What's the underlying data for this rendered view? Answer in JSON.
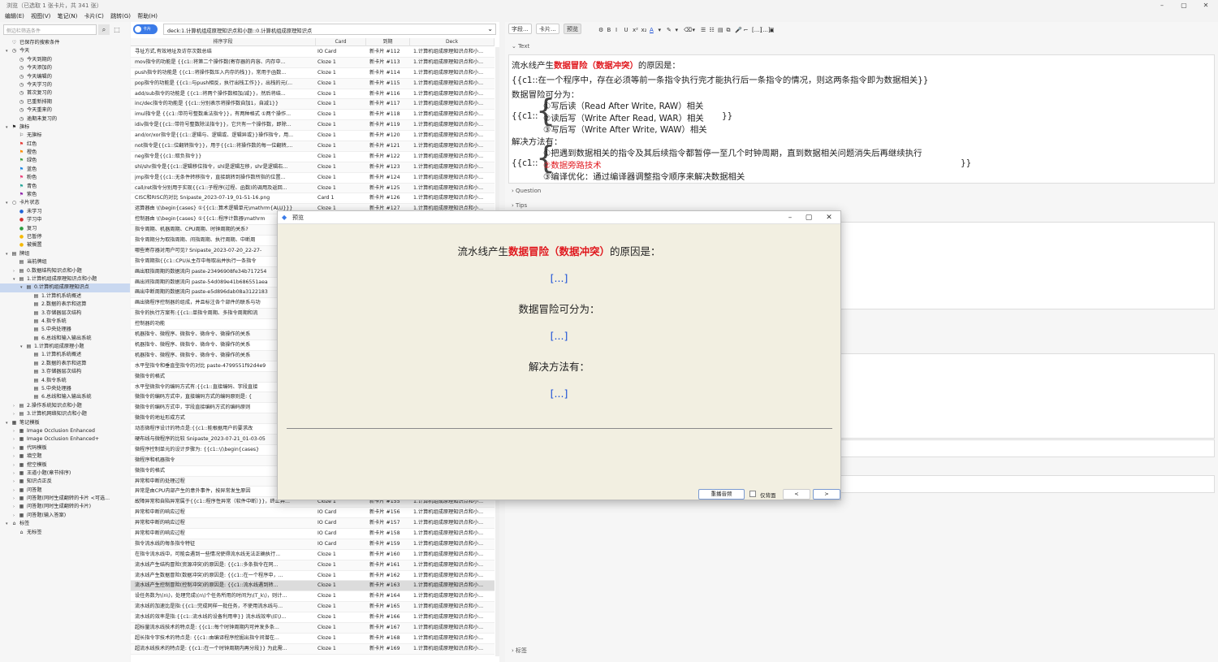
{
  "window": {
    "title": "浏览（已选取 1 张卡片，共 341 张）",
    "controls": [
      "–",
      "▢",
      "✕"
    ]
  },
  "menu": [
    "编辑(E)",
    "视图(V)",
    "笔记(N)",
    "卡片(C)",
    "跳转(G)",
    "帮助(H)"
  ],
  "sidebar": {
    "search_placeholder": "侧边栏筛选条件",
    "tree": [
      {
        "d": 0,
        "a": "",
        "i": "♡",
        "l": "已保存的搜索条件"
      },
      {
        "d": 0,
        "a": "▾",
        "i": "◷",
        "l": "今天"
      },
      {
        "d": 1,
        "a": "",
        "i": "◷",
        "l": "今天到期的"
      },
      {
        "d": 1,
        "a": "",
        "i": "◷",
        "l": "今天添加的"
      },
      {
        "d": 1,
        "a": "",
        "i": "◷",
        "l": "今天编辑的"
      },
      {
        "d": 1,
        "a": "",
        "i": "◷",
        "l": "今天学习的"
      },
      {
        "d": 1,
        "a": "",
        "i": "◷",
        "l": "首次复习的"
      },
      {
        "d": 1,
        "a": "",
        "i": "◷",
        "l": "已重新排期"
      },
      {
        "d": 1,
        "a": "",
        "i": "◷",
        "l": "今天重来的"
      },
      {
        "d": 1,
        "a": "",
        "i": "◷",
        "l": "逾期未复习的"
      },
      {
        "d": 0,
        "a": "▾",
        "i": "⚑",
        "l": "旗标"
      },
      {
        "d": 1,
        "a": "",
        "i": "⚐",
        "l": "无旗标"
      },
      {
        "d": 1,
        "a": "",
        "i": "⚑",
        "l": "红色",
        "c": "#e53935"
      },
      {
        "d": 1,
        "a": "",
        "i": "⚑",
        "l": "橙色",
        "c": "#fb8c00"
      },
      {
        "d": 1,
        "a": "",
        "i": "⚑",
        "l": "绿色",
        "c": "#43a047"
      },
      {
        "d": 1,
        "a": "",
        "i": "⚑",
        "l": "蓝色",
        "c": "#1e88e5"
      },
      {
        "d": 1,
        "a": "",
        "i": "⚑",
        "l": "粉色",
        "c": "#ec407a"
      },
      {
        "d": 1,
        "a": "",
        "i": "⚑",
        "l": "青色",
        "c": "#26a69a"
      },
      {
        "d": 1,
        "a": "",
        "i": "⚑",
        "l": "紫色",
        "c": "#8e24aa"
      },
      {
        "d": 0,
        "a": "▾",
        "i": "○",
        "l": "卡片状态"
      },
      {
        "d": 1,
        "a": "",
        "i": "●",
        "l": "未学习",
        "c": "#1e63d6"
      },
      {
        "d": 1,
        "a": "",
        "i": "●",
        "l": "学习中",
        "c": "#d32f2f"
      },
      {
        "d": 1,
        "a": "",
        "i": "●",
        "l": "复习",
        "c": "#2e9e3e"
      },
      {
        "d": 1,
        "a": "",
        "i": "●",
        "l": "已暂停",
        "c": "#f5b800"
      },
      {
        "d": 1,
        "a": "",
        "i": "●",
        "l": "被搁置",
        "c": "#f5b800"
      },
      {
        "d": 0,
        "a": "▾",
        "i": "▤",
        "l": "牌组"
      },
      {
        "d": 1,
        "a": "",
        "i": "▤",
        "l": "当前牌组"
      },
      {
        "d": 1,
        "a": "›",
        "i": "▤",
        "l": "0.数据结构知识点和小题"
      },
      {
        "d": 1,
        "a": "▾",
        "i": "▤",
        "l": "1.计算机组成原理知识点和小题"
      },
      {
        "d": 2,
        "a": "▾",
        "i": "▤",
        "l": "0.计算机组成原理知识点",
        "sel": true
      },
      {
        "d": 3,
        "a": "",
        "i": "▤",
        "l": "1.计算机系统概述"
      },
      {
        "d": 3,
        "a": "",
        "i": "▤",
        "l": "2.数据的表示和运算"
      },
      {
        "d": 3,
        "a": "",
        "i": "▤",
        "l": "3.存储器层次结构"
      },
      {
        "d": 3,
        "a": "",
        "i": "▤",
        "l": "4.指令系统"
      },
      {
        "d": 3,
        "a": "",
        "i": "▤",
        "l": "5.中央处理器"
      },
      {
        "d": 3,
        "a": "",
        "i": "▤",
        "l": "6.总线和输入输出系统"
      },
      {
        "d": 2,
        "a": "▾",
        "i": "▤",
        "l": "1.计算机组成原理小题"
      },
      {
        "d": 3,
        "a": "",
        "i": "▤",
        "l": "1.计算机系统概述"
      },
      {
        "d": 3,
        "a": "",
        "i": "▤",
        "l": "2.数据的表示和运算"
      },
      {
        "d": 3,
        "a": "",
        "i": "▤",
        "l": "3.存储器层次结构"
      },
      {
        "d": 3,
        "a": "",
        "i": "▤",
        "l": "4.指令系统"
      },
      {
        "d": 3,
        "a": "",
        "i": "▤",
        "l": "5.中央处理器"
      },
      {
        "d": 3,
        "a": "",
        "i": "▤",
        "l": "6.总线和输入输出系统"
      },
      {
        "d": 1,
        "a": "›",
        "i": "▤",
        "l": "2.操作系统知识点和小题"
      },
      {
        "d": 1,
        "a": "›",
        "i": "▤",
        "l": "3.计算机网络知识点和小题"
      },
      {
        "d": 0,
        "a": "▾",
        "i": "▦",
        "l": "笔记模板"
      },
      {
        "d": 1,
        "a": "›",
        "i": "▦",
        "l": "Image Occlusion Enhanced"
      },
      {
        "d": 1,
        "a": "›",
        "i": "▦",
        "l": "Image Occlusion Enhanced+"
      },
      {
        "d": 1,
        "a": "›",
        "i": "▦",
        "l": "代码模板"
      },
      {
        "d": 1,
        "a": "›",
        "i": "▦",
        "l": "填空题"
      },
      {
        "d": 1,
        "a": "›",
        "i": "▦",
        "l": "挖空模板"
      },
      {
        "d": 1,
        "a": "›",
        "i": "▦",
        "l": "王道小题(章节排序)"
      },
      {
        "d": 1,
        "a": "›",
        "i": "▦",
        "l": "知识点正反"
      },
      {
        "d": 1,
        "a": "›",
        "i": "▦",
        "l": "问答题"
      },
      {
        "d": 1,
        "a": "›",
        "i": "▦",
        "l": "问答题(同时生成翻转的卡片 <可选..."
      },
      {
        "d": 1,
        "a": "›",
        "i": "▦",
        "l": "问答题(同时生成翻转的卡片)"
      },
      {
        "d": 1,
        "a": "›",
        "i": "▦",
        "l": "问答题(输入答案)"
      },
      {
        "d": 0,
        "a": "▾",
        "i": "⌂",
        "l": "标签"
      },
      {
        "d": 1,
        "a": "",
        "i": "⌂",
        "l": "无标签"
      }
    ]
  },
  "browser": {
    "toggle_label": "卡片",
    "query": "deck:1.计算机组成原理知识点和小题::0.计算机组成原理知识点",
    "columns": [
      "排序字段",
      "Card",
      "到期",
      "Deck"
    ],
    "rows": [
      [
        "寻址方式,有效地址及访存次数总结",
        "IO Card",
        "新卡片 #112",
        "1.计算机组成原理知识点和小..."
      ],
      [
        "mov指令的功能是 {{c1::将第二个操作数(寄存器的内容、内存中...",
        "Cloze 1",
        "新卡片 #113",
        "1.计算机组成原理知识点和小..."
      ],
      [
        "push指令的功能是 {{c1::将操作数压入内存的栈}}，常用于函数...",
        "Cloze 1",
        "新卡片 #114",
        "1.计算机组成原理知识点和小..."
      ],
      [
        "pop指令的功能是 {{c1::与push相反，执行出栈工作}}，出栈的元(...",
        "Cloze 1",
        "新卡片 #115",
        "1.计算机组成原理知识点和小..."
      ],
      [
        "add/sub指令的功能是 {{c1::将两个操作数相加/减}}，然后将结...",
        "Cloze 1",
        "新卡片 #116",
        "1.计算机组成原理知识点和小..."
      ],
      [
        "inc/dec指令的功能是 {{c1::分别表示将操作数自加1，自减1}}",
        "Cloze 1",
        "新卡片 #117",
        "1.计算机组成原理知识点和小..."
      ],
      [
        "imul指令是 {{c1::带符号整数乘法指令}}，有两种格式 ①两个操作...",
        "Cloze 1",
        "新卡片 #118",
        "1.计算机组成原理知识点和小..."
      ],
      [
        "idiv指令是{{c1::带符号整数除法指令}}，它只有一个操作数，即除...",
        "Cloze 1",
        "新卡片 #119",
        "1.计算机组成原理知识点和小..."
      ],
      [
        "and/or/xor指令是{{c1::逻辑与、逻辑或、逻辑异或}}操作指令，用...",
        "Cloze 1",
        "新卡片 #120",
        "1.计算机组成原理知识点和小..."
      ],
      [
        "not指令是{{c1::位翻转指令}}，用于{{c1::将操作数的每一位翻转,...",
        "Cloze 1",
        "新卡片 #121",
        "1.计算机组成原理知识点和小..."
      ],
      [
        "neg指令是{{c1::取负指令}}",
        "Cloze 1",
        "新卡片 #122",
        "1.计算机组成原理知识点和小..."
      ],
      [
        "shl/shr指令是{{c1::逻辑移位指令，shl是逻辑左移，shr是逻辑右...",
        "Cloze 1",
        "新卡片 #123",
        "1.计算机组成原理知识点和小..."
      ],
      [
        "jmp指令是{{c1::无条件转移指令，直接跳转到操作数所指的位置...",
        "Cloze 1",
        "新卡片 #124",
        "1.计算机组成原理知识点和小..."
      ],
      [
        "call/ret指令分别用于实现{{c1::子程序(过程、函数)的调用及返回...",
        "Cloze 1",
        "新卡片 #125",
        "1.计算机组成原理知识点和小..."
      ],
      [
        "CISC和RISC的对比 Snipaste_2023-07-19_01-51-16.png",
        "Card 1",
        "新卡片 #126",
        "1.计算机组成原理知识点和小..."
      ],
      [
        "运算器由 \\(\\begin{cases} ①{{c1::算术逻辑单元\\mathrm{ALU}}}",
        "Cloze 1",
        "新卡片 #127",
        "1.计算机组成原理知识点和小..."
      ],
      [
        "控制器由 \\(\\begin{cases} ①{{c1::程序计数器\\mathrm",
        "",
        "",
        ""
      ],
      [
        "指令周期、机器周期、CPU周期、时钟周期的关系?",
        "",
        "",
        ""
      ],
      [
        "指令周期分为取指周期、间指周期、执行周期、中断周",
        "",
        "",
        ""
      ],
      [
        "哪些寄存器对用户可见?  Snipaste_2023-07-20_22-27-",
        "",
        "",
        ""
      ],
      [
        "指令周期指{{c1::CPU从主存中每取出并执行一条指令",
        "",
        "",
        ""
      ],
      [
        "画出取指周期的数据流向  paste-23496908fe34b717254",
        "",
        "",
        ""
      ],
      [
        "画出间指周期的数据流向  paste-54d089e41b686551aea",
        "",
        "",
        ""
      ],
      [
        "画出中断周期的数据流向  paste-e5d896dab08a3122183",
        "",
        "",
        ""
      ],
      [
        "画出微程序控制器的组成，并且标注各个部件的联系与功",
        "",
        "",
        ""
      ],
      [
        "指令的执行方案有:{{c1::单指令周期、多指令周期和流",
        "",
        "",
        ""
      ],
      [
        "控制器的功能",
        "",
        "",
        ""
      ],
      [
        "机器指令、微程序、微指令、微命令、微操作的关系",
        "",
        "",
        ""
      ],
      [
        "机器指令、微程序、微指令、微命令、微操作的关系",
        "",
        "",
        ""
      ],
      [
        "机器指令、微程序、微指令、微命令、微操作的关系",
        "",
        "",
        ""
      ],
      [
        "水平型指令和垂直型指令的对比  paste-4799551f92d4e9",
        "",
        "",
        ""
      ],
      [
        "微指令的格式",
        "",
        "",
        ""
      ],
      [
        "水平型微指令的编码方式有:{{c1::直接编码、字段直接",
        "",
        "",
        ""
      ],
      [
        "微指令的编码方式中，直接编码方式的编码原则是: {",
        "",
        "",
        ""
      ],
      [
        "微指令的编码方式中，字段直接编码方式的编码原则",
        "",
        "",
        ""
      ],
      [
        "微指令的地址形成方式",
        "",
        "",
        ""
      ],
      [
        "动态微程序设计的特点是:{{c1::能根据用户的要求改",
        "",
        "",
        ""
      ],
      [
        "硬布线与微程序的比较  Snipaste_2023-07-21_01-03-05",
        "",
        "",
        ""
      ],
      [
        "微程序控制单元的设计步骤为: {{c1::\\(\\begin{cases}",
        "",
        "",
        ""
      ],
      [
        "微程序和机器指令",
        "",
        "",
        ""
      ],
      [
        "微指令的格式",
        "",
        "",
        ""
      ],
      [
        "异常和中断的处理过程",
        "",
        "",
        ""
      ],
      [
        "异常是由CPU内部产生的意外事件，按异常发生原因",
        "",
        "",
        ""
      ],
      [
        "故障异常和自陷异常属于{{c1::程序性异常（软件中断）}}，终止异...",
        "Cloze 1",
        "新卡片 #155",
        "1.计算机组成原理知识点和小..."
      ],
      [
        "异常和中断的响应过程",
        "IO Card",
        "新卡片 #156",
        "1.计算机组成原理知识点和小..."
      ],
      [
        "异常和中断的响应过程",
        "IO Card",
        "新卡片 #157",
        "1.计算机组成原理知识点和小..."
      ],
      [
        "异常和中断的响应过程",
        "IO Card",
        "新卡片 #158",
        "1.计算机组成原理知识点和小..."
      ],
      [
        "指令流水线的每条指令特征",
        "IO Card",
        "新卡片 #159",
        "1.计算机组成原理知识点和小..."
      ],
      [
        "在指令流水线中，可能会遇到一些情况使得流水线无法正确执行...",
        "Cloze 1",
        "新卡片 #160",
        "1.计算机组成原理知识点和小..."
      ],
      [
        "流水线产生结构冒险(资源冲突)的原因是: {{c1::多条指令在同...",
        "Cloze 1",
        "新卡片 #161",
        "1.计算机组成原理知识点和小..."
      ],
      [
        "流水线产生数据冒险(数据冲突)的原因是: {{c1::在一个程序中，...",
        "Cloze 1",
        "新卡片 #162",
        "1.计算机组成原理知识点和小..."
      ],
      [
        "流水线产生控制冒险(控制冲突)的原因是: {{c1::流水线遇到转...",
        "Cloze 1",
        "新卡片 #163",
        "1.计算机组成原理知识点和小..."
      ],
      [
        "设任务数为\\(n\\)，处理完成\\(n\\)个任务所用的时间为\\(T_k\\)，则计...",
        "Cloze 1",
        "新卡片 #164",
        "1.计算机组成原理知识点和小..."
      ],
      [
        "流水线的加速比是指:{{c1::完成同样一批任务，不使用流水线与...",
        "Cloze 1",
        "新卡片 #165",
        "1.计算机组成原理知识点和小..."
      ],
      [
        "流水线的效率是指:{{c1::流水线的设备利用率}} 流水线效率\\(E\\)...",
        "Cloze 1",
        "新卡片 #166",
        "1.计算机组成原理知识点和小..."
      ],
      [
        "超标量流水线技术的特点是: {{c1::每个时钟周期内可并发多条...",
        "Cloze 1",
        "新卡片 #167",
        "1.计算机组成原理知识点和小..."
      ],
      [
        "超长指令字技术的特点是: {{c1::由编译程序挖掘出指令间潜在...",
        "Cloze 1",
        "新卡片 #168",
        "1.计算机组成原理知识点和小..."
      ],
      [
        "超流水线技术的特点是: {{c1::在一个时钟周期内再分段}} 为此需...",
        "Cloze 1",
        "新卡片 #169",
        "1.计算机组成原理知识点和小..."
      ]
    ],
    "selected_row": 51
  },
  "editor": {
    "toolbar": {
      "fields": "字段...",
      "cards": "卡片...",
      "preview": "预览",
      "buttons": [
        "⚙",
        "B",
        "I",
        "U",
        "x²",
        "x₂",
        "A",
        "▾",
        "✎",
        "▾",
        "⌫",
        "▾",
        "☰",
        "☷",
        "▤",
        "⧉",
        "🎤",
        "⌐",
        "[...]",
        "[...]",
        "▣"
      ]
    },
    "field_labels": {
      "text": "Text",
      "question": "Question",
      "tips": "Tips",
      "tags": "标签"
    },
    "text": {
      "l1a": "流水线产生",
      "l1b": "数据冒险（数据冲突）",
      "l1c": "的原因是：",
      "l2": "{{c1::在一个程序中，存在必须等前一条指令执行完才能执行后一条指令的情况，则这两条指令即为数据相关}}",
      "l3": "数据冒险可分为：",
      "c1open": "{{c1::",
      "c1close": "}}",
      "hz1": "①写后读（Read After Write, RAW）相关",
      "hz2": "②读后写（Write After Read, WAR）相关",
      "hz3": "③写后写（Write After Write, WAW）相关",
      "l4": "解决方法有：",
      "s1": "①把遇到数据相关的指令及其后续指令都暂停一至几个时钟周期，直到数据相关问题消失后再继续执行",
      "s2": "②数据旁路技术",
      "s3": "③编译优化：通过编译器调整指令顺序来解决数据相关",
      "c2close": "}}"
    }
  },
  "preview": {
    "title": "预览",
    "l1a": "流水线产生",
    "l1b": "数据冒险（数据冲突）",
    "l1c": "的原因是：",
    "cloze": "[...]",
    "l2": "数据冒险可分为：",
    "l3": "解决方法有：",
    "replay": "重播音频",
    "back_only": "仅背面",
    "prev": "<",
    "next": ">"
  }
}
